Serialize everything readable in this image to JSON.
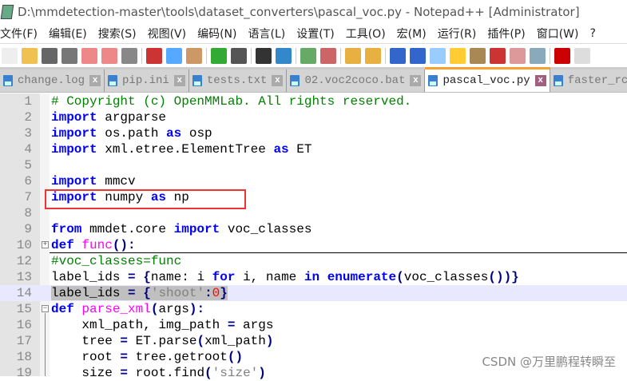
{
  "title": "D:\\mmdetection-master\\tools\\dataset_converters\\pascal_voc.py - Notepad++ [Administrator]",
  "menu": [
    "文件(F)",
    "编辑(E)",
    "搜索(S)",
    "视图(V)",
    "编码(N)",
    "语言(L)",
    "设置(T)",
    "工具(O)",
    "宏(M)",
    "运行(R)",
    "插件(P)",
    "窗口(W)",
    "?"
  ],
  "tabs": [
    {
      "label": "change.log"
    },
    {
      "label": "pip.ini"
    },
    {
      "label": "tests.txt"
    },
    {
      "label": "02.voc2coco.bat"
    },
    {
      "label": "pascal_voc.py",
      "active": true
    },
    {
      "label": "faster_rcnn"
    }
  ],
  "lines": [
    {
      "n": "1",
      "html": "<span class='cm'># Copyright (c) OpenMMLab. All rights reserved.</span>"
    },
    {
      "n": "2",
      "html": "<span class='kw'>import</span> argparse"
    },
    {
      "n": "3",
      "html": "<span class='kw'>import</span> os.path <span class='kw'>as</span> osp"
    },
    {
      "n": "4",
      "html": "<span class='kw'>import</span> xml.etree.ElementTree <span class='kw'>as</span> ET"
    },
    {
      "n": "5",
      "html": ""
    },
    {
      "n": "6",
      "html": "<span class='kw'>import</span> mmcv"
    },
    {
      "n": "7",
      "html": "<span class='kw'>import</span> numpy <span class='kw'>as</span> np"
    },
    {
      "n": "8",
      "html": ""
    },
    {
      "n": "9",
      "html": "<span class='kw'>from</span> mmdet.core <span class='kw'>import</span> voc_classes"
    },
    {
      "n": "10",
      "html": "<span class='kw'>def</span> <span class='fn'>func</span><span class='op'>():</span>"
    },
    {
      "n": "12",
      "html": "<span class='cm'>#voc_classes=func</span>"
    },
    {
      "n": "13",
      "html": "label_ids <span class='op'>=</span> <span class='op'>{</span>name: i <span class='kw'>for</span> i, name <span class='kw'>in</span> <span class='kw'>enumerate</span><span class='op'>(</span>voc_classes<span class='op'>())}</span>"
    },
    {
      "n": "14",
      "html": "<span class='sel'>label_ids <span class='op'>=</span> <span class='op'>{</span><span class='st'>'shoot'</span><span class='op'>:</span><span class='nm'>0</span><span class='op'>}</span></span>"
    },
    {
      "n": "15",
      "html": "<span class='kw'>def</span> <span class='fn'>parse_xml</span><span class='op'>(</span>args<span class='op'>):</span>"
    },
    {
      "n": "16",
      "html": "    xml_path, img_path <span class='op'>=</span> args"
    },
    {
      "n": "17",
      "html": "    tree <span class='op'>=</span> ET.parse<span class='op'>(</span>xml_path<span class='op'>)</span>"
    },
    {
      "n": "18",
      "html": "    root <span class='op'>=</span> tree.getroot<span class='op'>()</span>"
    },
    {
      "n": "19",
      "html": "    size <span class='op'>=</span> root.find<span class='op'>(</span><span class='st'>'size'</span><span class='op'>)</span>"
    }
  ],
  "watermark": "CSDN @万里鹏程转瞬至",
  "colors": {
    "keyword": "#0000ff",
    "comment": "#008000",
    "function": "#ff00ff",
    "string": "#808080",
    "number": "#ff0000",
    "highlight_box": "#ee3333",
    "active_tab": "#f7a030"
  }
}
